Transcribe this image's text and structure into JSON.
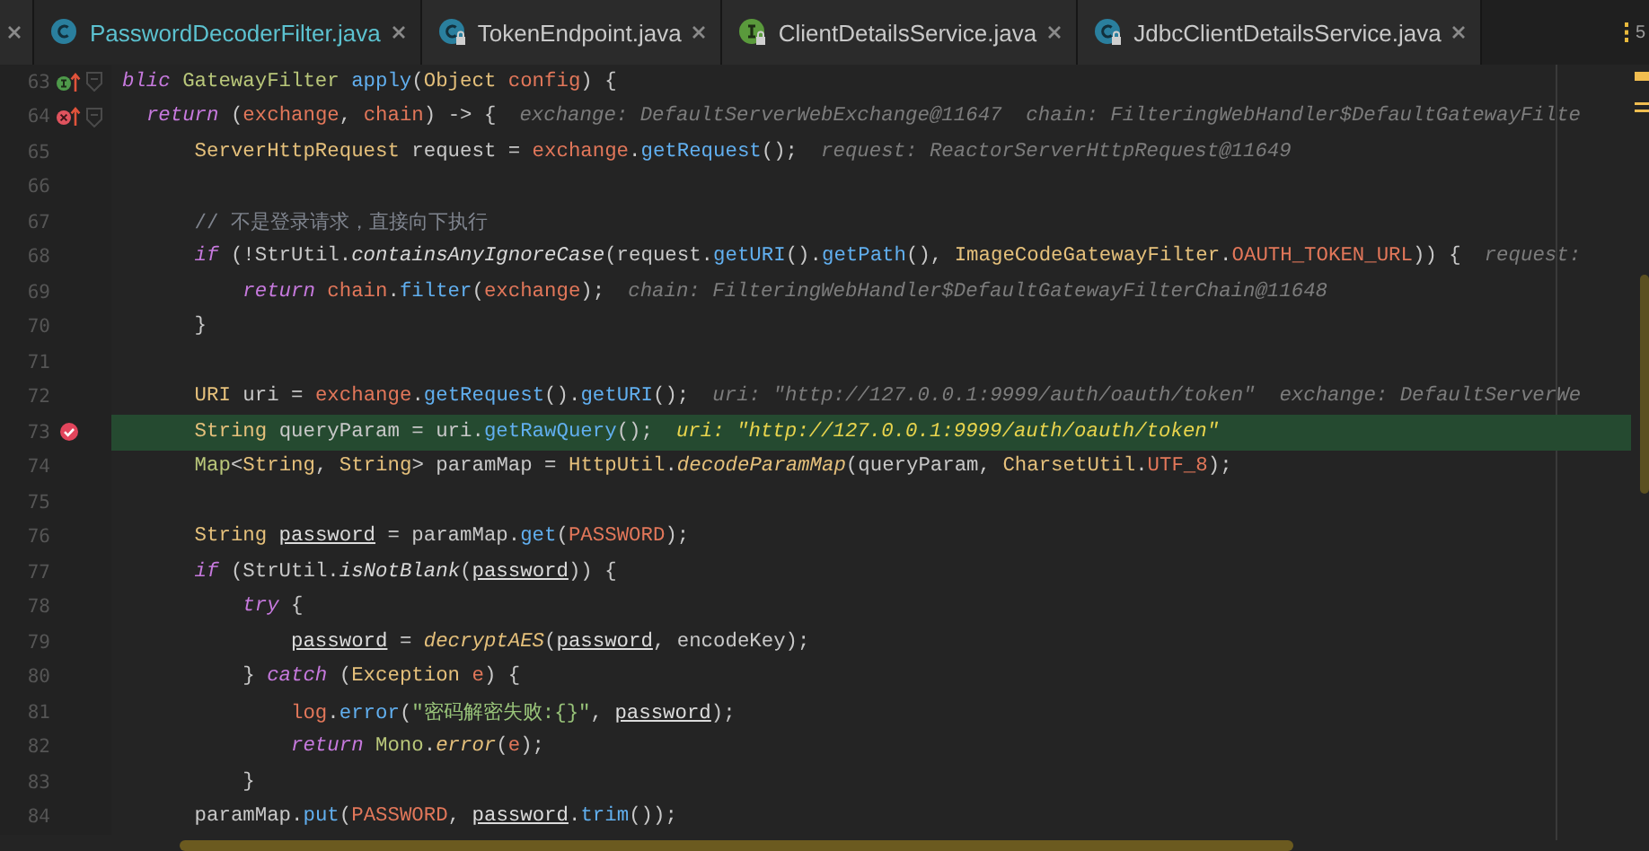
{
  "tabs": [
    {
      "label": "PasswordDecoderFilter.java",
      "kind": "class",
      "locked": false,
      "selected": true
    },
    {
      "label": "TokenEndpoint.java",
      "kind": "class",
      "locked": true,
      "selected": false
    },
    {
      "label": "ClientDetailsService.java",
      "kind": "interface",
      "locked": true,
      "selected": false
    },
    {
      "label": "JdbcClientDetailsService.java",
      "kind": "class",
      "locked": true,
      "selected": false
    }
  ],
  "tab_overflow": "5",
  "lines": [
    {
      "number": "63",
      "gutter": {
        "kind": "implements"
      },
      "fold": true,
      "current": false,
      "tokens": [
        {
          "text": "blic ",
          "kind": "kw"
        },
        {
          "text": "GatewayFilter ",
          "kind": "tg"
        },
        {
          "text": "apply",
          "kind": "m"
        },
        {
          "text": "("
        },
        {
          "text": "Object ",
          "kind": "ty"
        },
        {
          "text": "config",
          "kind": "v"
        },
        {
          "text": ") {"
        }
      ]
    },
    {
      "number": "64",
      "gutter": {
        "kind": "lambda"
      },
      "fold": true,
      "current": false,
      "tokens": [
        {
          "text": "  return",
          "kind": "kw"
        },
        {
          "text": " ("
        },
        {
          "text": "exchange",
          "kind": "v"
        },
        {
          "text": ", "
        },
        {
          "text": "chain",
          "kind": "v"
        },
        {
          "text": ") -> {"
        }
      ],
      "hint": "exchange: DefaultServerWebExchange@11647  chain: FilteringWebHandler$DefaultGatewayFilte"
    },
    {
      "number": "65",
      "current": false,
      "tokens": [
        {
          "text": "      ServerHttpRequest",
          "kind": "ty"
        },
        {
          "text": " request = "
        },
        {
          "text": "exchange",
          "kind": "v"
        },
        {
          "text": "."
        },
        {
          "text": "getRequest",
          "kind": "m"
        },
        {
          "text": "();"
        }
      ],
      "hint": "request: ReactorServerHttpRequest@11649"
    },
    {
      "number": "66",
      "current": false
    },
    {
      "number": "67",
      "current": false,
      "tokens": [
        {
          "text": "      // 不是登录请求，直接向下执行",
          "kind": "cm"
        }
      ]
    },
    {
      "number": "68",
      "current": false,
      "tokens": [
        {
          "text": "      if",
          "kind": "kw"
        },
        {
          "text": " (!StrUtil."
        },
        {
          "text": "containsAnyIgnoreCase",
          "kind": "si"
        },
        {
          "text": "(request."
        },
        {
          "text": "getURI",
          "kind": "m"
        },
        {
          "text": "()."
        },
        {
          "text": "getPath",
          "kind": "m"
        },
        {
          "text": "(), "
        },
        {
          "text": "ImageCodeGatewayFilter",
          "kind": "ty"
        },
        {
          "text": "."
        },
        {
          "text": "OAUTH_TOKEN_URL",
          "kind": "v"
        },
        {
          "text": ")) {"
        }
      ],
      "hint": "request:"
    },
    {
      "number": "69",
      "current": false,
      "tokens": [
        {
          "text": "          return ",
          "kind": "kw"
        },
        {
          "text": "chain",
          "kind": "v"
        },
        {
          "text": "."
        },
        {
          "text": "filter",
          "kind": "m"
        },
        {
          "text": "("
        },
        {
          "text": "exchange",
          "kind": "v"
        },
        {
          "text": ");"
        }
      ],
      "hint": "chain: FilteringWebHandler$DefaultGatewayFilterChain@11648"
    },
    {
      "number": "70",
      "current": false,
      "tokens": [
        {
          "text": "      }"
        }
      ]
    },
    {
      "number": "71",
      "current": false
    },
    {
      "number": "72",
      "current": false,
      "tokens": [
        {
          "text": "      URI",
          "kind": "ty"
        },
        {
          "text": " uri = "
        },
        {
          "text": "exchange",
          "kind": "v"
        },
        {
          "text": "."
        },
        {
          "text": "getRequest",
          "kind": "m"
        },
        {
          "text": "()."
        },
        {
          "text": "getURI",
          "kind": "m"
        },
        {
          "text": "();"
        }
      ],
      "hint": "uri: \"http://127.0.0.1:9999/auth/oauth/token\"  exchange: DefaultServerWe"
    },
    {
      "number": "73",
      "gutter": {
        "kind": "breakpoint"
      },
      "current": true,
      "tokens": [
        {
          "text": "      String",
          "kind": "ty"
        },
        {
          "text": " queryParam = uri."
        },
        {
          "text": "getRawQuery",
          "kind": "m"
        },
        {
          "text": "();"
        }
      ],
      "hint": "uri: \"http://127.0.0.1:9999/auth/oauth/token\""
    },
    {
      "number": "74",
      "current": false,
      "tokens": [
        {
          "text": "      Map",
          "kind": "tg"
        },
        {
          "text": "<"
        },
        {
          "text": "String",
          "kind": "ty"
        },
        {
          "text": ", "
        },
        {
          "text": "String",
          "kind": "ty"
        },
        {
          "text": "> paramMap = "
        },
        {
          "text": "HttpUtil",
          "kind": "ty"
        },
        {
          "text": "."
        },
        {
          "text": "decodeParamMap",
          "kind": "sy"
        },
        {
          "text": "(queryParam, "
        },
        {
          "text": "CharsetUtil",
          "kind": "ty"
        },
        {
          "text": "."
        },
        {
          "text": "UTF_8",
          "kind": "v"
        },
        {
          "text": ");"
        }
      ]
    },
    {
      "number": "75",
      "current": false
    },
    {
      "number": "76",
      "current": false,
      "tokens": [
        {
          "text": "      String ",
          "kind": "ty"
        },
        {
          "text": "password",
          "kind": "u"
        },
        {
          "text": " = paramMap."
        },
        {
          "text": "get",
          "kind": "m"
        },
        {
          "text": "("
        },
        {
          "text": "PASSWORD",
          "kind": "v"
        },
        {
          "text": ");"
        }
      ]
    },
    {
      "number": "77",
      "current": false,
      "tokens": [
        {
          "text": "      if",
          "kind": "kw"
        },
        {
          "text": " (StrUtil."
        },
        {
          "text": "isNotBlank",
          "kind": "si"
        },
        {
          "text": "("
        },
        {
          "text": "password",
          "kind": "u"
        },
        {
          "text": ")) {"
        }
      ]
    },
    {
      "number": "78",
      "current": false,
      "tokens": [
        {
          "text": "          try",
          "kind": "kw"
        },
        {
          "text": " {"
        }
      ]
    },
    {
      "number": "79",
      "current": false,
      "tokens": [
        {
          "text": "              password",
          "kind": "u"
        },
        {
          "text": " = "
        },
        {
          "text": "decryptAES",
          "kind": "sy"
        },
        {
          "text": "("
        },
        {
          "text": "password",
          "kind": "u"
        },
        {
          "text": ", encodeKey);"
        }
      ]
    },
    {
      "number": "80",
      "current": false,
      "tokens": [
        {
          "text": "          } "
        },
        {
          "text": "catch",
          "kind": "kw"
        },
        {
          "text": " ("
        },
        {
          "text": "Exception ",
          "kind": "ty"
        },
        {
          "text": "e",
          "kind": "v"
        },
        {
          "text": ") {"
        }
      ]
    },
    {
      "number": "81",
      "current": false,
      "tokens": [
        {
          "text": "              log",
          "kind": "v"
        },
        {
          "text": "."
        },
        {
          "text": "error",
          "kind": "m"
        },
        {
          "text": "("
        },
        {
          "text": "\"密码解密失败:{}\"",
          "kind": "str"
        },
        {
          "text": ", "
        },
        {
          "text": "password",
          "kind": "u"
        },
        {
          "text": ");"
        }
      ]
    },
    {
      "number": "82",
      "current": false,
      "tokens": [
        {
          "text": "              return ",
          "kind": "kw"
        },
        {
          "text": "Mono",
          "kind": "tg"
        },
        {
          "text": "."
        },
        {
          "text": "error",
          "kind": "sy"
        },
        {
          "text": "("
        },
        {
          "text": "e",
          "kind": "v"
        },
        {
          "text": ");"
        }
      ]
    },
    {
      "number": "83",
      "current": false,
      "tokens": [
        {
          "text": "          }"
        }
      ]
    },
    {
      "number": "84",
      "current": false,
      "tokens": [
        {
          "text": "      paramMap."
        },
        {
          "text": "put",
          "kind": "m"
        },
        {
          "text": "("
        },
        {
          "text": "PASSWORD",
          "kind": "v"
        },
        {
          "text": ", "
        },
        {
          "text": "password",
          "kind": "u"
        },
        {
          "text": "."
        },
        {
          "text": "trim",
          "kind": "m"
        },
        {
          "text": "());"
        }
      ]
    }
  ]
}
